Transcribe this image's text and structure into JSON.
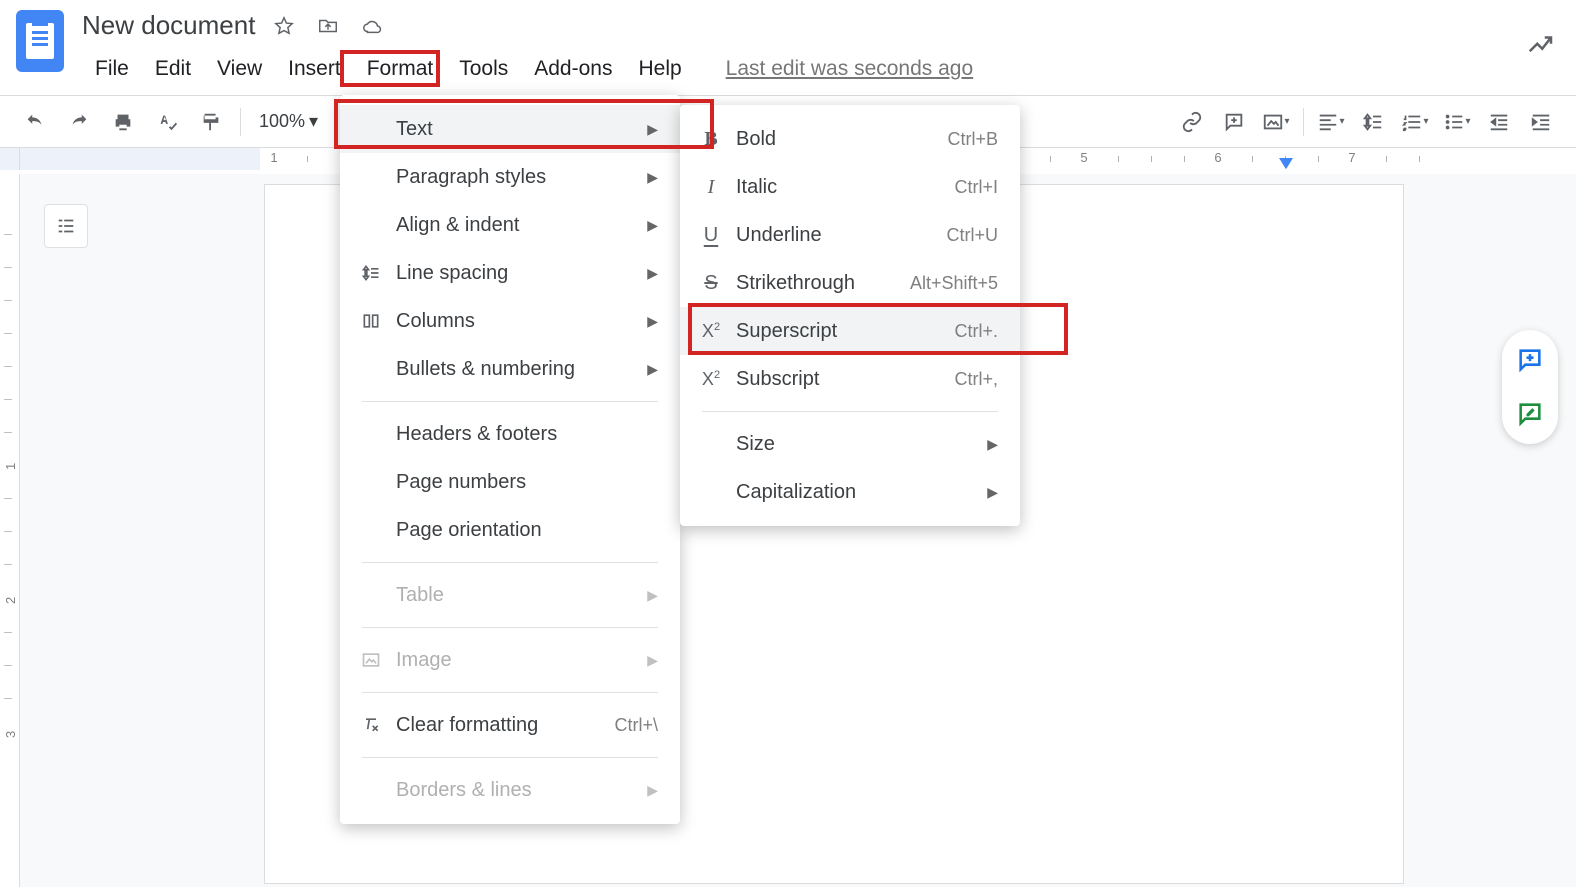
{
  "header": {
    "title": "New document",
    "last_edit": "Last edit was seconds ago"
  },
  "menubar": {
    "file": "File",
    "edit": "Edit",
    "view": "View",
    "insert": "Insert",
    "format": "Format",
    "tools": "Tools",
    "addons": "Add-ons",
    "help": "Help"
  },
  "toolbar": {
    "zoom": "100%"
  },
  "ruler": {
    "n1": "1",
    "n5": "5",
    "n6": "6",
    "n7": "7"
  },
  "vruler": {
    "n1": "1",
    "n2": "2",
    "n3": "3"
  },
  "format_menu": {
    "text": "Text",
    "paragraph_styles": "Paragraph styles",
    "align_indent": "Align & indent",
    "line_spacing": "Line spacing",
    "columns": "Columns",
    "bullets_numbering": "Bullets & numbering",
    "headers_footers": "Headers & footers",
    "page_numbers": "Page numbers",
    "page_orientation": "Page orientation",
    "table": "Table",
    "image": "Image",
    "clear_formatting": "Clear formatting",
    "clear_formatting_sc": "Ctrl+\\",
    "borders_lines": "Borders & lines"
  },
  "text_submenu": {
    "bold": "Bold",
    "bold_sc": "Ctrl+B",
    "italic": "Italic",
    "italic_sc": "Ctrl+I",
    "underline": "Underline",
    "underline_sc": "Ctrl+U",
    "strikethrough": "Strikethrough",
    "strikethrough_sc": "Alt+Shift+5",
    "superscript": "Superscript",
    "superscript_sc": "Ctrl+.",
    "subscript": "Subscript",
    "subscript_sc": "Ctrl+,",
    "size": "Size",
    "capitalization": "Capitalization"
  }
}
